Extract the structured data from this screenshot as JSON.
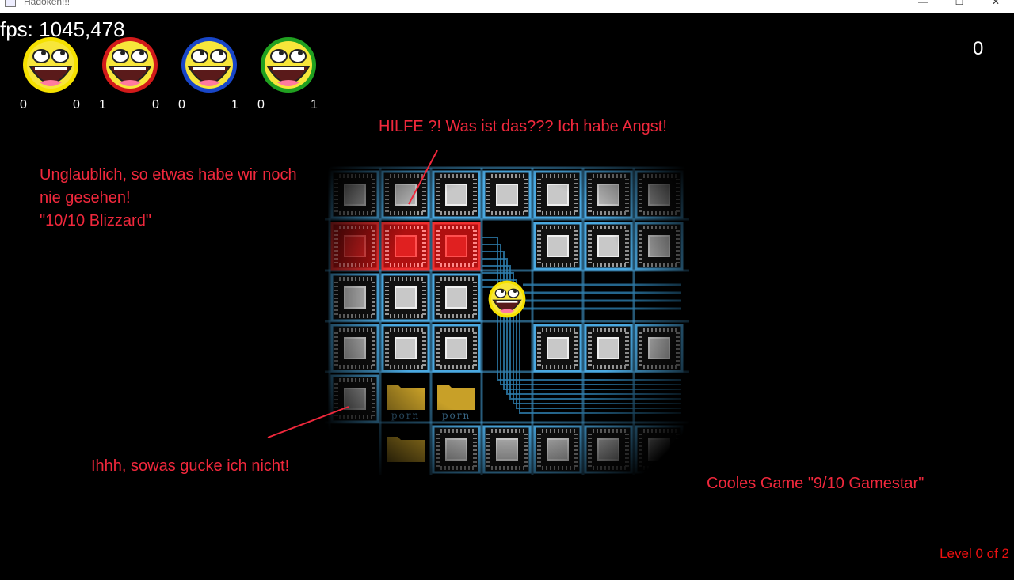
{
  "window": {
    "title": "Hadoken!!!",
    "min_label": "—",
    "max_label": "☐",
    "close_label": "✕"
  },
  "hud": {
    "fps": "fps: 1045,478",
    "score": "0",
    "level": "Level 0 of 2",
    "players": [
      {
        "color": "#f5e100",
        "left": "0",
        "right": "0"
      },
      {
        "color": "#d21a1a",
        "left": "1",
        "right": "0"
      },
      {
        "color": "#1846c8",
        "left": "0",
        "right": "1"
      },
      {
        "color": "#20a020",
        "left": "0",
        "right": "1"
      }
    ]
  },
  "annotations": {
    "hilfe": "HILFE ?! Was ist das??? Ich habe Angst!",
    "unglaublich": "Unglaublich, so etwas habe wir noch\nnie gesehen!\n\"10/10 Blizzard\"",
    "ihhh": "Ihhh, sowas gucke ich nicht!",
    "cooles": "Cooles Game \"9/10 Gamestar\""
  },
  "board": {
    "folder_label": "porn",
    "colors": {
      "wire": "#4aa8e0",
      "chip_red": "#e02020",
      "folder": "#c8a028",
      "folder_text": "#3a6a8a"
    }
  }
}
